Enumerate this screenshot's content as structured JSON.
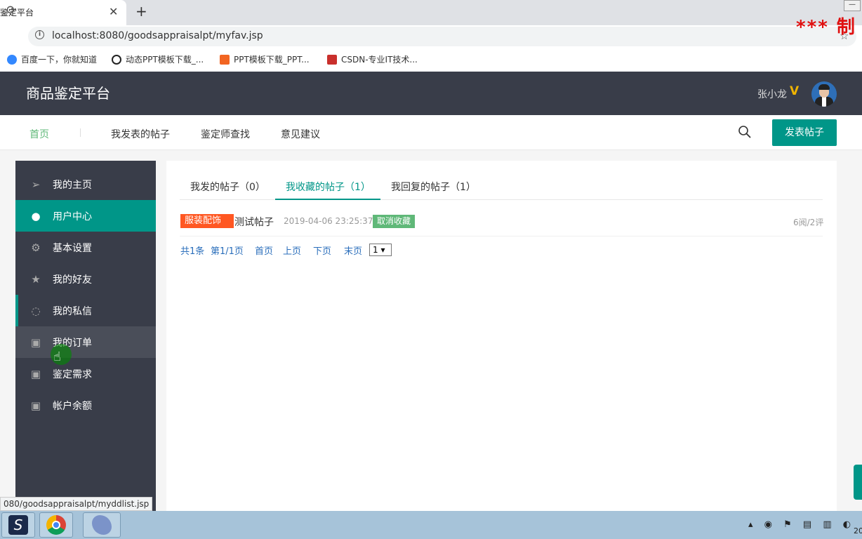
{
  "browser": {
    "tab_title": "鉴定平台",
    "close_glyph": "✕",
    "new_tab_glyph": "+",
    "url": "localhost:8080/goodsappraisalpt/myfav.jsp",
    "watermark": "*** 制",
    "bookmarks": [
      {
        "label": "百度一下，你就知道",
        "icon": "baidu-paw-icon",
        "color": "#3388ff"
      },
      {
        "label": "动态PPT模板下载_...",
        "icon": "panda-icon",
        "color": "#222222"
      },
      {
        "label": "PPT模板下载_PPT...",
        "icon": "ppt-icon",
        "color": "#f26522"
      },
      {
        "label": "CSDN-专业IT技术...",
        "icon": "csdn-icon",
        "color": "#c9302c"
      }
    ],
    "status_url": "080/goodsappraisalpt/myddlist.jsp"
  },
  "header": {
    "logo": "商品鉴定平台",
    "user_name": "张小龙",
    "vip_badge": "V"
  },
  "nav": {
    "items": [
      "首页",
      "我发表的帖子",
      "鉴定师查找",
      "意见建议"
    ],
    "active_index": 0,
    "post_button": "发表帖子"
  },
  "sidebar": {
    "items": [
      {
        "label": "我的主页",
        "icon": "paper-plane-icon"
      },
      {
        "label": "用户中心",
        "icon": "user-icon"
      },
      {
        "label": "基本设置",
        "icon": "gear-icon"
      },
      {
        "label": "我的好友",
        "icon": "star-icon"
      },
      {
        "label": "我的私信",
        "icon": "chat-bubble-icon"
      },
      {
        "label": "我的订单",
        "icon": "image-icon"
      },
      {
        "label": "鉴定需求",
        "icon": "image-icon"
      },
      {
        "label": "帐户余额",
        "icon": "image-icon"
      }
    ],
    "active_index": 1,
    "hover_index": 5
  },
  "content": {
    "tabs": [
      "我发的帖子（0）",
      "我收藏的帖子（1）",
      "我回复的帖子（1）"
    ],
    "active_tab": 1,
    "posts": [
      {
        "category": "服装配饰",
        "title": "测试帖子",
        "time": "2019-04-06 23:25:37",
        "action": "取消收藏",
        "stats": "6阅/2评"
      }
    ],
    "pagination": {
      "total": "共1条",
      "page": "第1/1页",
      "first": "首页",
      "prev": "上页",
      "next": "下页",
      "last": "末页",
      "select_value": "1 ▾"
    }
  },
  "colors": {
    "accent": "#009688",
    "header_bg": "#393d49",
    "badge_red": "#ff5722",
    "badge_green": "#5fb878",
    "link": "#2a6ebb"
  }
}
